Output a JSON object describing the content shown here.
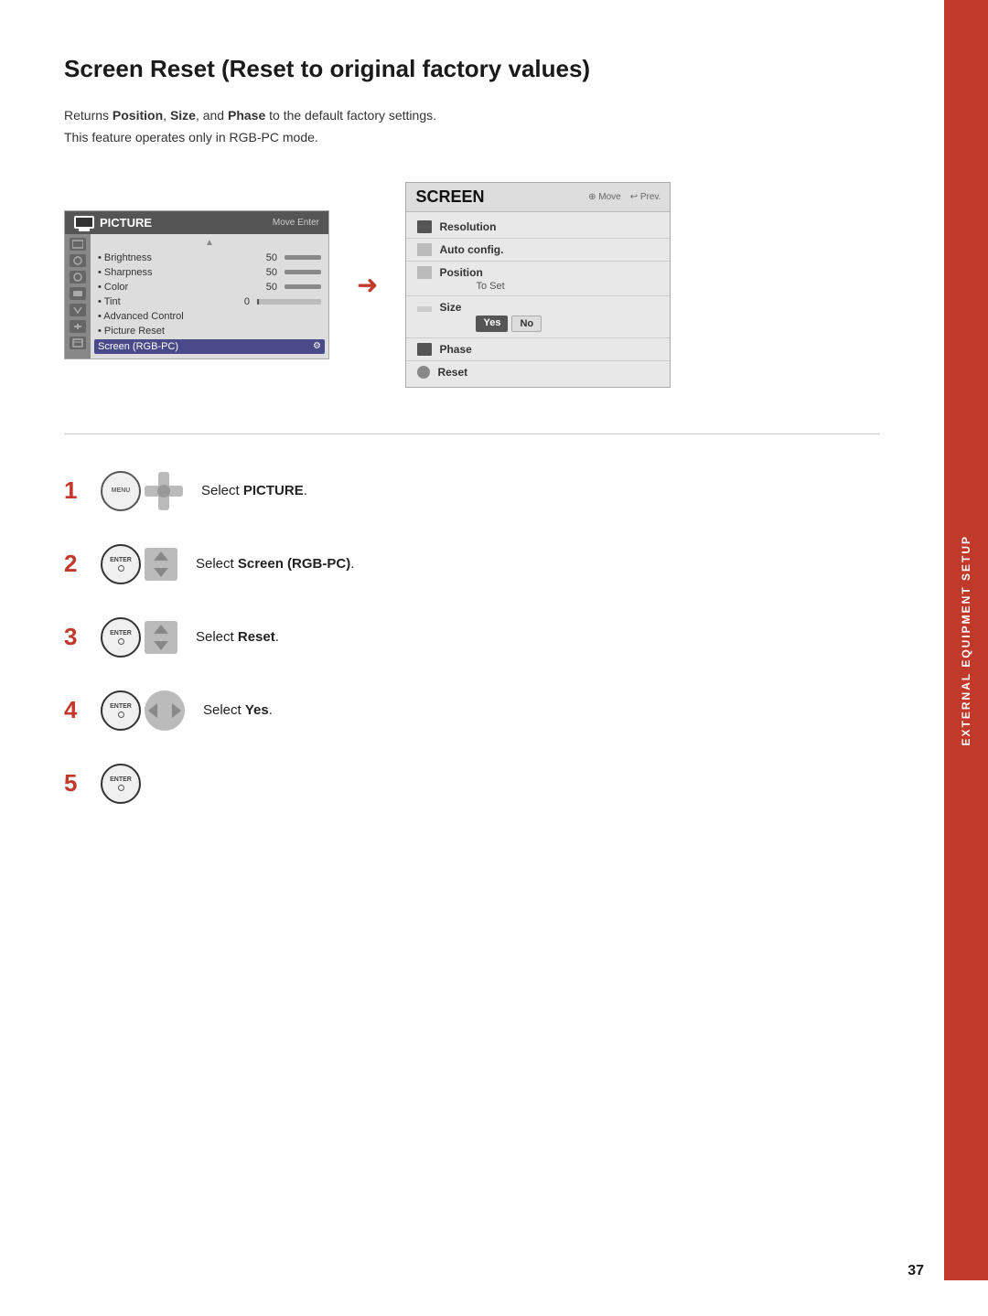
{
  "page": {
    "title": "Screen Reset (Reset to original factory values)",
    "description_line1": "Returns Position, Size, and Phase to the default factory settings.",
    "description_line2": "This feature operates only in RGB-PC mode.",
    "sidebar_label": "EXTERNAL EQUIPMENT SETUP",
    "page_number": "37"
  },
  "picture_menu": {
    "title": "PICTURE",
    "nav_hint": "Move  Enter",
    "items": [
      {
        "label": "• Brightness",
        "value": "50"
      },
      {
        "label": "• Sharpness",
        "value": "50"
      },
      {
        "label": "• Color",
        "value": "50"
      },
      {
        "label": "• Tint",
        "value": "0"
      },
      {
        "label": "• Advanced Control",
        "value": ""
      },
      {
        "label": "• Picture Reset",
        "value": ""
      },
      {
        "label": "Screen (RGB-PC)",
        "value": "",
        "highlighted": true
      }
    ]
  },
  "screen_menu": {
    "title": "SCREEN",
    "nav_move": "Move",
    "nav_prev": "Prev.",
    "items": [
      {
        "label": "Resolution",
        "icon": "plus"
      },
      {
        "label": "Auto config.",
        "icon": "minus"
      },
      {
        "label": "Position",
        "icon": "minus",
        "sub": "To Set"
      },
      {
        "label": "Size",
        "icon": "bar",
        "sub_buttons": [
          "Yes",
          "No"
        ]
      },
      {
        "label": "Phase",
        "icon": "plus"
      },
      {
        "label": "Reset",
        "icon": "circle"
      }
    ]
  },
  "steps": [
    {
      "number": "1",
      "icons": [
        "menu-btn",
        "nav-cross"
      ],
      "text_pre": "Select ",
      "text_bold": "PICTURE",
      "text_post": "."
    },
    {
      "number": "2",
      "icons": [
        "enter-btn",
        "nav-updown"
      ],
      "text_pre": "Select ",
      "text_bold": "Screen (RGB-PC)",
      "text_post": "."
    },
    {
      "number": "3",
      "icons": [
        "enter-btn",
        "nav-updown"
      ],
      "text_pre": "Select ",
      "text_bold": "Reset",
      "text_post": "."
    },
    {
      "number": "4",
      "icons": [
        "enter-btn",
        "nav-leftright"
      ],
      "text_pre": "Select ",
      "text_bold": "Yes",
      "text_post": "."
    },
    {
      "number": "5",
      "icons": [
        "enter-btn-only"
      ],
      "text_pre": "",
      "text_bold": "",
      "text_post": ""
    }
  ]
}
